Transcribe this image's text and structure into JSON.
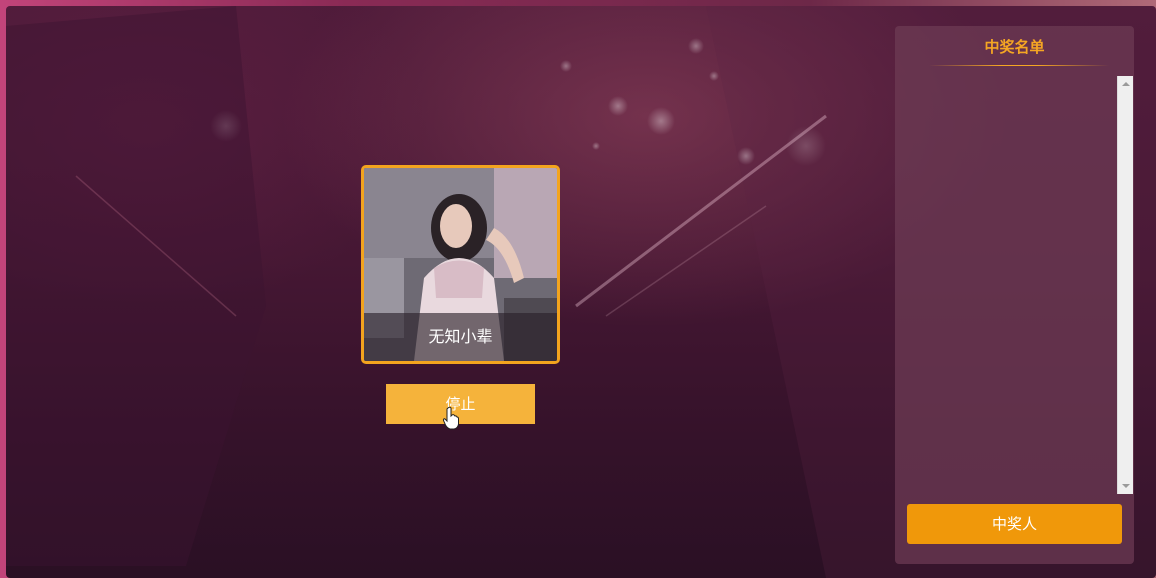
{
  "lottery": {
    "current_name": "无知小辈",
    "stop_label": "停止"
  },
  "winners_panel": {
    "title": "中奖名单",
    "winners": [],
    "button_label": "中奖人"
  },
  "colors": {
    "accent": "#f3a41e",
    "stop_button": "#f5b33b",
    "winner_button": "#f0980a",
    "panel_title": "#f5a623"
  }
}
